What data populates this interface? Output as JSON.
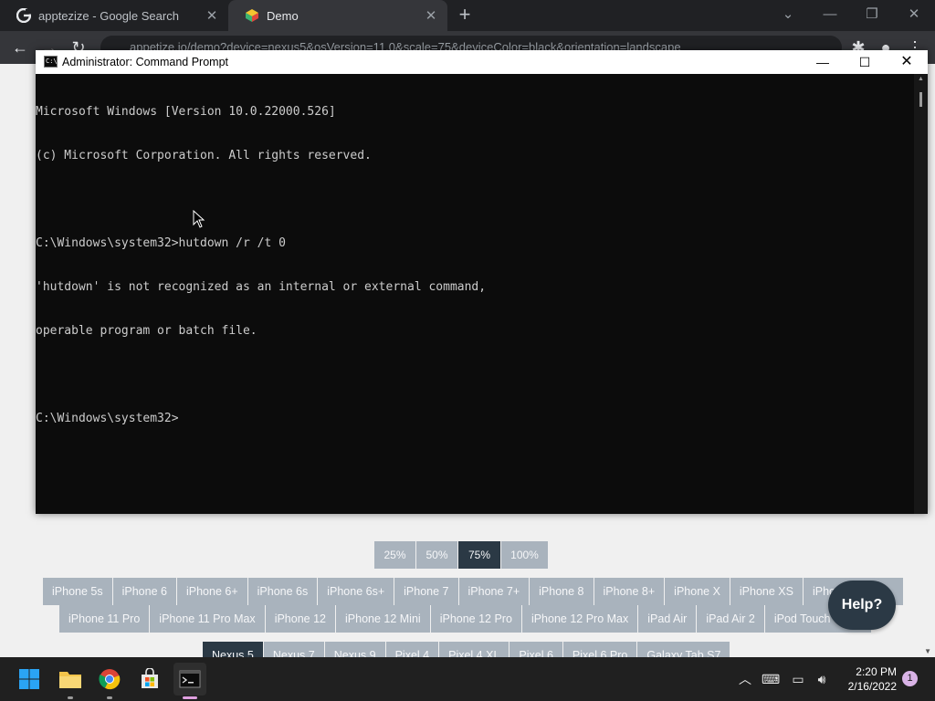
{
  "browser": {
    "tabs": [
      {
        "title": "apptezize - Google Search",
        "icon": "google-icon",
        "active": false
      },
      {
        "title": "Demo",
        "icon": "appetize-icon",
        "active": true
      }
    ],
    "url": "appetize.io/demo?device=nexus5&osVersion=11.0&scale=75&deviceColor=black&orientation=landscape"
  },
  "cmd": {
    "title": "Administrator: Command Prompt",
    "lines": [
      "Microsoft Windows [Version 10.0.22000.526]",
      "(c) Microsoft Corporation. All rights reserved.",
      "",
      "C:\\Windows\\system32>hutdown /r /t 0",
      "'hutdown' is not recognized as an internal or external command,",
      "operable program or batch file.",
      "",
      "C:\\Windows\\system32>"
    ]
  },
  "scales": [
    "25%",
    "50%",
    "75%",
    "100%"
  ],
  "selected_scale": "75%",
  "devices_row1": [
    "iPhone 5s",
    "iPhone 6",
    "iPhone 6+",
    "iPhone 6s",
    "iPhone 6s+",
    "iPhone 7",
    "iPhone 7+",
    "iPhone 8",
    "iPhone 8+",
    "iPhone X",
    "iPhone XS",
    "iPhone X"
  ],
  "devices_row2": [
    "iPhone 11 Pro",
    "iPhone 11 Pro Max",
    "iPhone 12",
    "iPhone 12 Mini",
    "iPhone 12 Pro",
    "iPhone 12 Pro Max",
    "iPad Air",
    "iPad Air 2",
    "iPod Touch 7th G"
  ],
  "devices_row3": [
    "Nexus 5",
    "Nexus 7",
    "Nexus 9",
    "Pixel 4",
    "Pixel 4 XL",
    "Pixel 6",
    "Pixel 6 Pro",
    "Galaxy Tab S7"
  ],
  "selected_device": "Nexus 5",
  "help_label": "Help?",
  "taskbar": {
    "time": "2:20 PM",
    "date": "2/16/2022",
    "notification_count": "1"
  }
}
